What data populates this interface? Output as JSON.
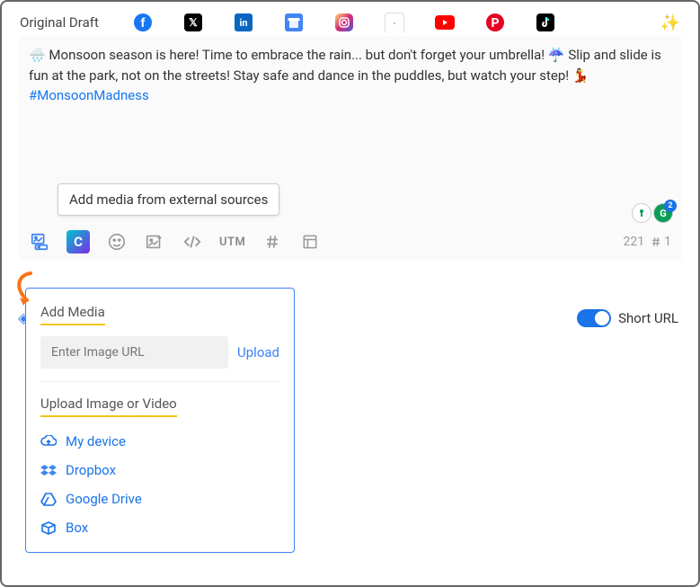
{
  "header": {
    "title": "Original Draft",
    "networks": [
      "facebook",
      "x",
      "linkedin",
      "google",
      "instagram",
      "threads",
      "youtube",
      "pinterest",
      "tiktok"
    ]
  },
  "post": {
    "text_part1": "Monsoon season is here! Time to embrace the rain... but don't forget your umbrella!",
    "text_part2": "Slip and slide is fun at the park, not on the streets! Stay safe and dance in the puddles, but watch your step!",
    "hashtag": "#MonsoonMadness"
  },
  "tooltip": "Add media from external sources",
  "toolbar": {
    "canva": "C",
    "utm": "UTM",
    "char_count": "221",
    "hashtag_count": "1"
  },
  "badges": {
    "grammarly_count": "2"
  },
  "popup": {
    "title": "Add Media",
    "url_placeholder": "Enter Image URL",
    "upload": "Upload",
    "section_title": "Upload Image or Video",
    "sources": {
      "device": "My device",
      "dropbox": "Dropbox",
      "gdrive": "Google Drive",
      "box": "Box"
    }
  },
  "short_url": {
    "label": "Short URL"
  }
}
